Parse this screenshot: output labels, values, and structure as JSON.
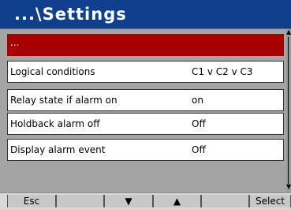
{
  "header": {
    "title": "...\\Settings"
  },
  "rows": [
    {
      "label": "...",
      "value": ""
    },
    {
      "label": "Logical conditions",
      "value": "C1 v C2 v C3"
    },
    {
      "label": "Relay state if alarm on",
      "value": "on"
    },
    {
      "label": "Holdback alarm off",
      "value": "Off"
    },
    {
      "label": "Display alarm event",
      "value": "Off"
    }
  ],
  "footer": {
    "keys": [
      "Esc",
      "",
      "▼",
      "▲",
      "",
      "Select"
    ]
  },
  "colors": {
    "title_bar": "#103f8e",
    "selected_row": "#a80000",
    "background": "#a4a4a4"
  },
  "icons": {
    "scroll_up": "chevron-up-icon",
    "scroll_down": "chevron-down-icon"
  }
}
